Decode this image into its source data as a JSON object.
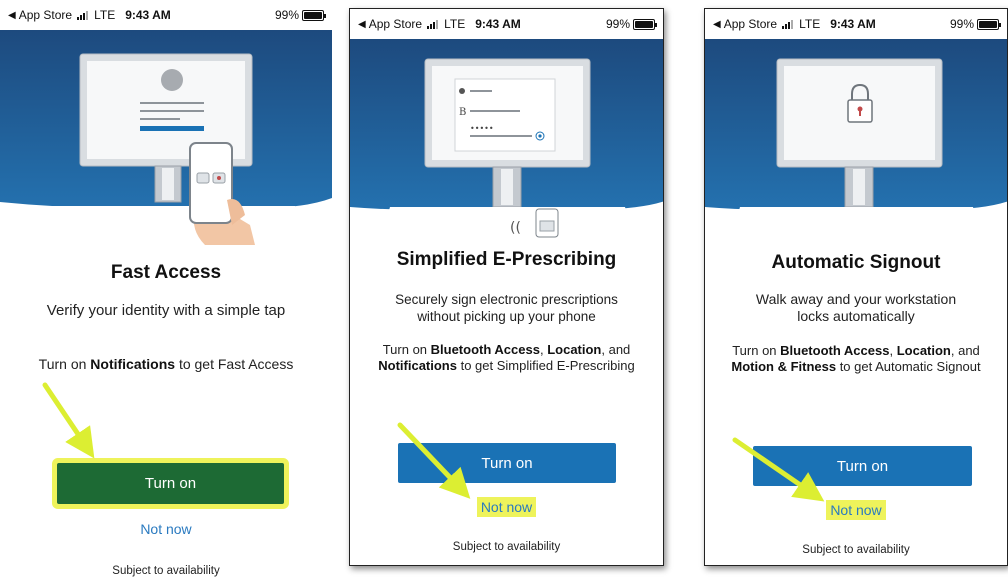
{
  "status_bar": {
    "back_label": "App Store",
    "network": "LTE",
    "time": "9:43 AM",
    "battery": "99%"
  },
  "screens": [
    {
      "title": "Fast Access",
      "description": "Verify your identity with a simple tap",
      "instruction": {
        "prefix": "Turn on ",
        "b1": "Notifications",
        "suffix": " to get Fast Access"
      },
      "primary_button": "Turn on",
      "secondary_link": "Not now",
      "footnote": "Subject to availability"
    },
    {
      "title": "Simplified E-Prescribing",
      "description": "Securely sign electronic prescriptions without picking up your phone",
      "instruction": {
        "prefix": "Turn on ",
        "b1": "Bluetooth Access",
        "mid1": ", ",
        "b2": "Location",
        "mid2": ", and ",
        "b3": "Notifications",
        "suffix": " to get Simplified E-Prescribing"
      },
      "primary_button": "Turn on",
      "secondary_link": "Not now",
      "footnote": "Subject to availability"
    },
    {
      "title": "Automatic Signout",
      "description": "Walk away and your workstation locks automatically",
      "instruction": {
        "prefix": "Turn on ",
        "b1": "Bluetooth Access",
        "mid1": ", ",
        "b2": "Location",
        "mid2": ", and ",
        "b3": "Motion & Fitness",
        "suffix": " to get Automatic Signout"
      },
      "primary_button": "Turn on",
      "secondary_link": "Not now",
      "footnote": "Subject to availability"
    }
  ],
  "colors": {
    "hero_gradient_top": "#1d4a7e",
    "hero_gradient_bottom": "#1f6aa8",
    "primary_button": "#1a72b5",
    "highlighted_button": "#1d6a34",
    "highlight": "#eef35b",
    "link": "#2a7ac0",
    "arrow": "#dcee32"
  }
}
